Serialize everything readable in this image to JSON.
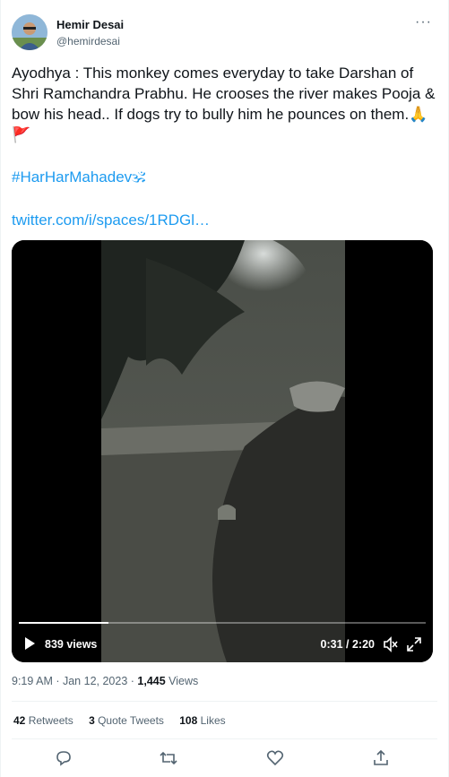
{
  "author": {
    "display_name": "Hemir Desai",
    "handle": "@hemirdesai"
  },
  "more_label": "···",
  "tweet": {
    "text": "Ayodhya : This monkey comes everyday to take Darshan of Shri Ramchandra Prabhu. He crooses the river makes Pooja & bow his head.. If dogs try to bully him he pounces on them.🙏🚩",
    "hashtag": "#HarHarMahadev🕉",
    "link": "twitter.com/i/spaces/1RDGl…"
  },
  "video": {
    "views": "839 views",
    "time": "0:31 / 2:20",
    "progress": 0.22
  },
  "meta": {
    "time": "9:19 AM",
    "sep1": " · ",
    "date": "Jan 12, 2023",
    "sep2": " · ",
    "views_count": "1,445",
    "views_label": " Views"
  },
  "stats": {
    "retweets_count": "42",
    "retweets_label": " Retweets",
    "quotes_count": "3",
    "quotes_label": " Quote Tweets",
    "likes_count": "108",
    "likes_label": " Likes"
  },
  "actions": [
    "reply-icon",
    "retweet-icon",
    "like-icon",
    "share-icon"
  ],
  "colors": {
    "link": "#1d9bf0",
    "secondary_text": "#536471",
    "primary_text": "#0f1419",
    "divider": "#eff3f4"
  }
}
